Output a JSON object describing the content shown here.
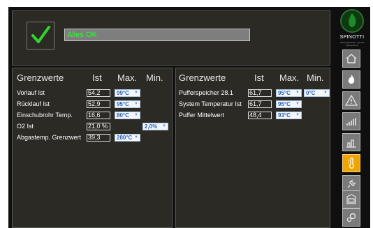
{
  "status": {
    "message": "Alles OK"
  },
  "brand": {
    "name": "SPINOTTI",
    "tagline": "Heizungstechnik · Spinotti Heizsysteme"
  },
  "left_panel": {
    "headers": {
      "title": "Grenzwerte",
      "ist": "Ist",
      "max": "Max.",
      "min": "Min."
    },
    "rows": [
      {
        "label": "Vorlauf Ist",
        "ist": "54,2",
        "max": "99°C",
        "min": ""
      },
      {
        "label": "Rücklauf Ist",
        "ist": "52,9",
        "max": "95°C",
        "min": ""
      },
      {
        "label": "Einschubrohr Temp.",
        "ist": "16,6",
        "max": "80°C",
        "min": ""
      },
      {
        "label": "O2 Ist",
        "ist": "21,0 %",
        "max": "",
        "min": "2,0%"
      },
      {
        "label": "Abgastemp. Grenzwert",
        "ist": "39,3",
        "max": "280°C",
        "min": ""
      }
    ]
  },
  "right_panel": {
    "headers": {
      "title": "Grenzwerte",
      "ist": "Ist",
      "max": "Max.",
      "min": "Min."
    },
    "rows": [
      {
        "label": "Pufferspeicher 28.1",
        "ist": "61,7",
        "max": "95°C",
        "min": "0°C"
      },
      {
        "label": "System Temperatur Ist",
        "ist": "61,7",
        "max": "95°C",
        "min": ""
      },
      {
        "label": "Puffer Mittelwert",
        "ist": "48,4",
        "max": "93°C",
        "min": ""
      }
    ]
  },
  "nav": [
    {
      "icon": "home-icon",
      "active": false
    },
    {
      "icon": "flame-icon",
      "active": false
    },
    {
      "icon": "warning-icon",
      "active": false
    },
    {
      "icon": "bar-chart-icon",
      "active": false
    },
    {
      "icon": "column-chart-icon",
      "active": false
    },
    {
      "icon": "thermometer-icon",
      "active": true
    },
    {
      "icon": "plug-icon",
      "active": false
    },
    {
      "icon": "boiler-icon",
      "active": false
    },
    {
      "icon": "gears-icon",
      "active": false
    }
  ],
  "colors": {
    "ok_text": "#2bff2b",
    "active_nav": "#f0a400",
    "select_text": "#2a62b8"
  }
}
